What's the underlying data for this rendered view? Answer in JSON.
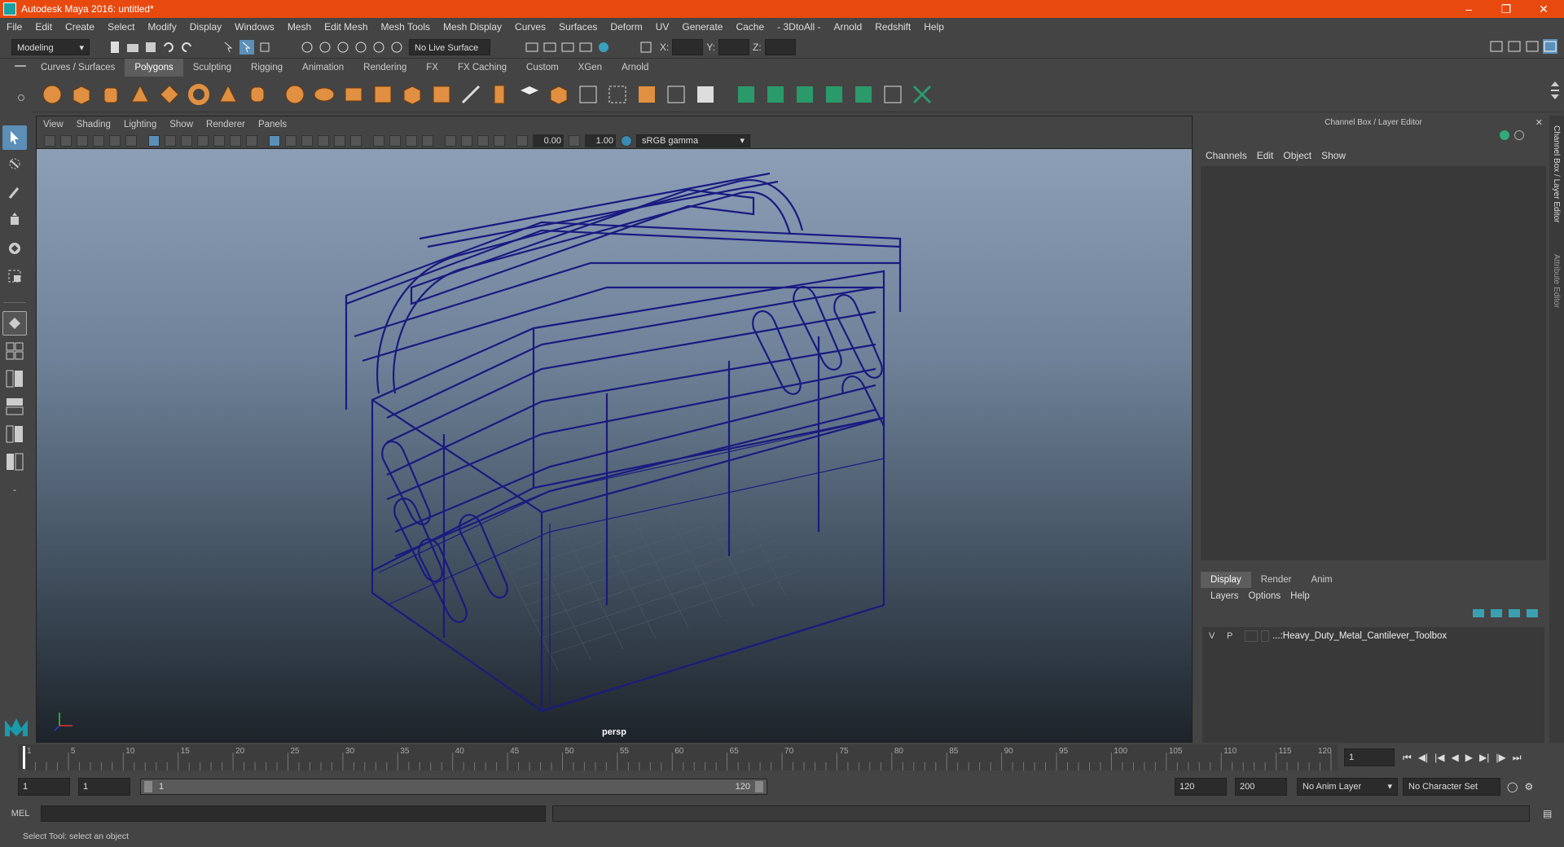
{
  "window": {
    "title": "Autodesk Maya 2016: untitled*"
  },
  "menu": [
    "File",
    "Edit",
    "Create",
    "Select",
    "Modify",
    "Display",
    "Windows",
    "Mesh",
    "Edit Mesh",
    "Mesh Tools",
    "Mesh Display",
    "Curves",
    "Surfaces",
    "Deform",
    "UV",
    "Generate",
    "Cache",
    "- 3DtoAll -",
    "Arnold",
    "Redshift",
    "Help"
  ],
  "statusline": {
    "mode": "Modeling",
    "live_surface": "No Live Surface",
    "x_label": "X:",
    "y_label": "Y:",
    "z_label": "Z:"
  },
  "shelf_tabs": [
    {
      "label": "Curves / Surfaces",
      "active": false
    },
    {
      "label": "Polygons",
      "active": true
    },
    {
      "label": "Sculpting",
      "active": false
    },
    {
      "label": "Rigging",
      "active": false
    },
    {
      "label": "Animation",
      "active": false
    },
    {
      "label": "Rendering",
      "active": false
    },
    {
      "label": "FX",
      "active": false
    },
    {
      "label": "FX Caching",
      "active": false
    },
    {
      "label": "Custom",
      "active": false
    },
    {
      "label": "XGen",
      "active": false
    },
    {
      "label": "Arnold",
      "active": false
    }
  ],
  "viewport": {
    "menu": [
      "View",
      "Shading",
      "Lighting",
      "Show",
      "Renderer",
      "Panels"
    ],
    "exposure": "0.00",
    "gamma": "1.00",
    "color_space": "sRGB gamma",
    "camera": "persp"
  },
  "channel_box": {
    "title": "Channel Box / Layer Editor",
    "menu": [
      "Channels",
      "Edit",
      "Object",
      "Show"
    ],
    "layer_tabs": [
      {
        "label": "Display",
        "active": true
      },
      {
        "label": "Render",
        "active": false
      },
      {
        "label": "Anim",
        "active": false
      }
    ],
    "layer_menu": [
      "Layers",
      "Options",
      "Help"
    ],
    "layer": {
      "v": "V",
      "p": "P",
      "name": "...:Heavy_Duty_Metal_Cantilever_Toolbox"
    },
    "side_tabs": [
      "Channel Box / Layer Editor",
      "Attribute Editor"
    ]
  },
  "timeline": {
    "ticks": [
      "1",
      "5",
      "10",
      "15",
      "20",
      "25",
      "30",
      "35",
      "40",
      "45",
      "50",
      "55",
      "60",
      "65",
      "70",
      "75",
      "80",
      "85",
      "90",
      "95",
      "100",
      "105",
      "110",
      "115",
      "120"
    ],
    "current_frame": "1",
    "range_start": "1",
    "range_inner_start": "1",
    "slider_start": "1",
    "slider_end": "120",
    "range_end": "120",
    "anim_end": "200",
    "anim_layer": "No Anim Layer",
    "character_set": "No Character Set"
  },
  "command_line": {
    "label": "MEL"
  },
  "help_line": "Select Tool: select an object",
  "colors": {
    "title_bar": "#e8490f",
    "wireframe": "#1a1a80",
    "active_tool": "#5b8fb8"
  }
}
